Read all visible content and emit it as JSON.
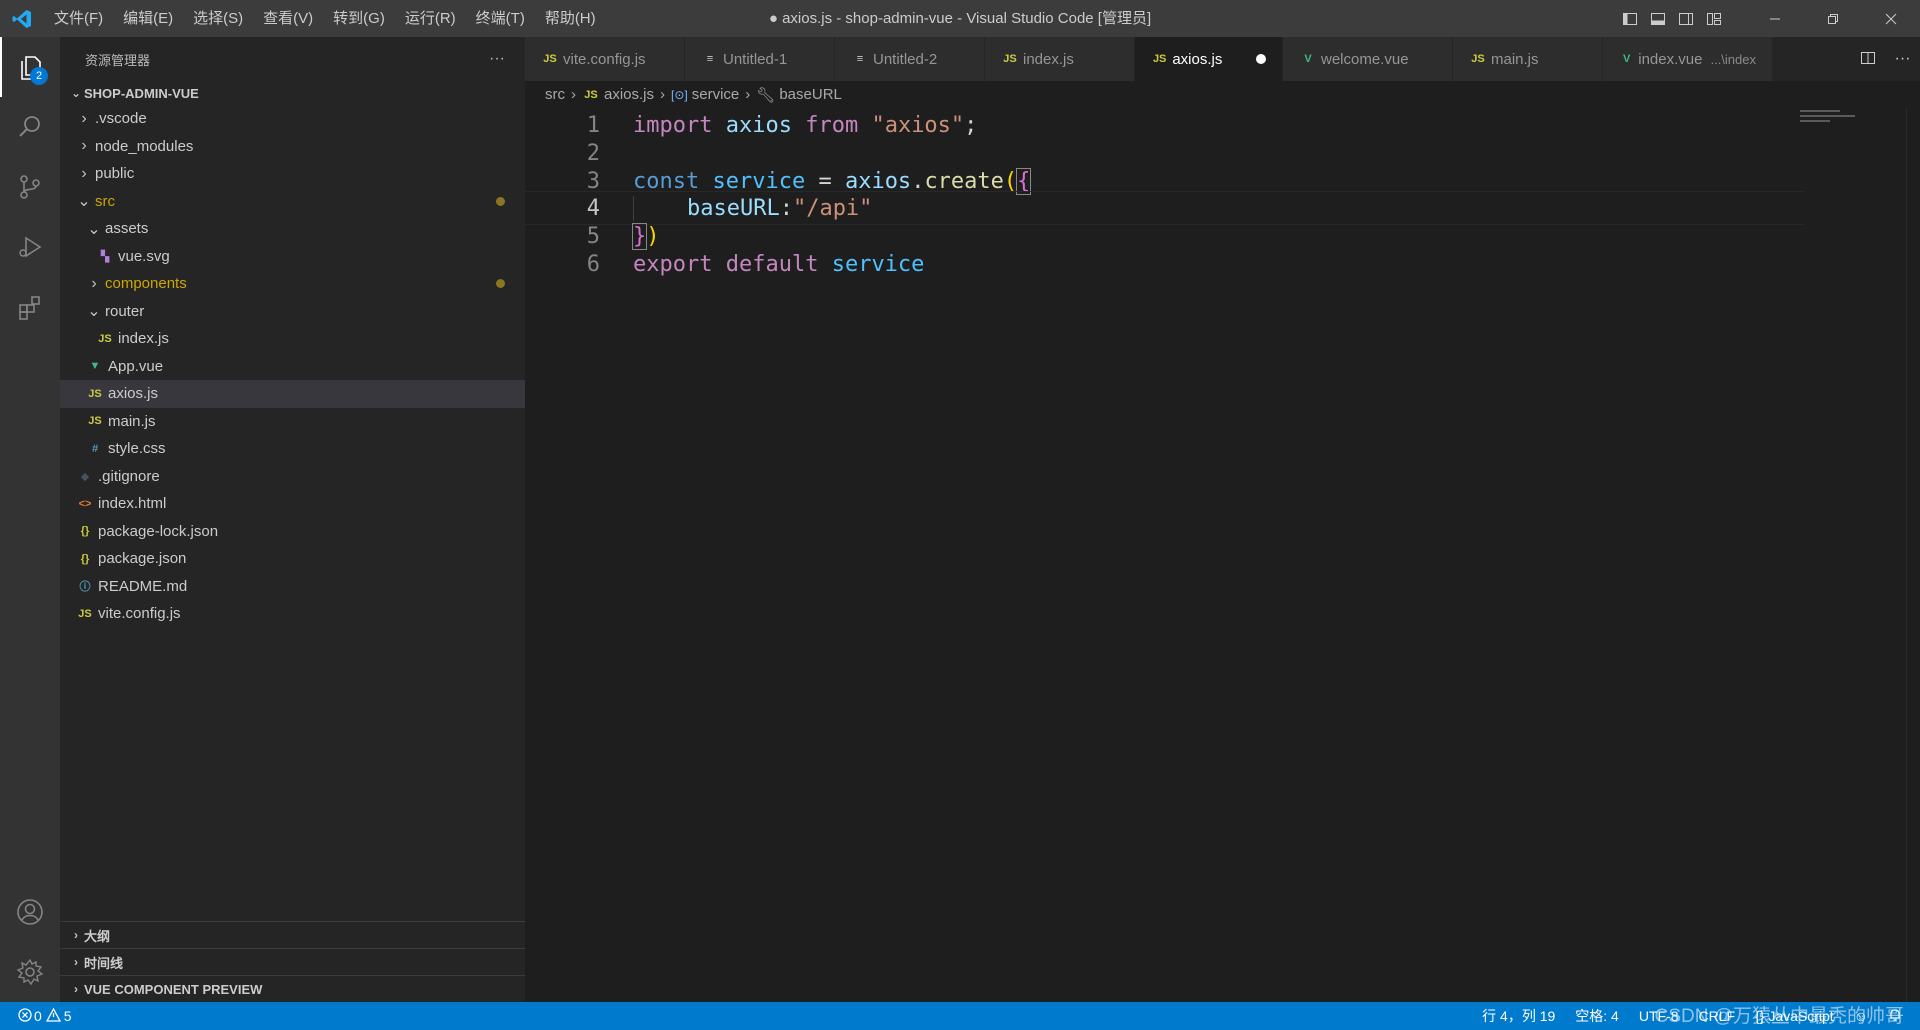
{
  "window": {
    "title": "● axios.js - shop-admin-vue - Visual Studio Code [管理员]"
  },
  "menu": [
    "文件(F)",
    "编辑(E)",
    "选择(S)",
    "查看(V)",
    "转到(G)",
    "运行(R)",
    "终端(T)",
    "帮助(H)"
  ],
  "activity": {
    "explorer_badge": "2"
  },
  "sidebar": {
    "header": "资源管理器",
    "more": "···",
    "project": "SHOP-ADMIN-VUE",
    "tree": [
      {
        "label": ".vscode",
        "type": "folder",
        "expanded": false,
        "depth": 1
      },
      {
        "label": "node_modules",
        "type": "folder",
        "expanded": false,
        "depth": 1
      },
      {
        "label": "public",
        "type": "folder",
        "expanded": false,
        "depth": 1
      },
      {
        "label": "src",
        "type": "folder",
        "expanded": true,
        "depth": 1
      },
      {
        "label": "assets",
        "type": "folder",
        "expanded": true,
        "depth": 2
      },
      {
        "label": "vue.svg",
        "type": "svg",
        "depth": 3
      },
      {
        "label": "components",
        "type": "folder",
        "expanded": false,
        "depth": 2
      },
      {
        "label": "router",
        "type": "folder",
        "expanded": true,
        "depth": 2
      },
      {
        "label": "index.js",
        "type": "js",
        "depth": 3
      },
      {
        "label": "App.vue",
        "type": "vue",
        "depth": 2
      },
      {
        "label": "axios.js",
        "type": "js",
        "depth": 2
      },
      {
        "label": "main.js",
        "type": "js",
        "depth": 2
      },
      {
        "label": "style.css",
        "type": "css",
        "depth": 2
      },
      {
        "label": ".gitignore",
        "type": "git",
        "depth": 1
      },
      {
        "label": "index.html",
        "type": "html",
        "depth": 1
      },
      {
        "label": "package-lock.json",
        "type": "json",
        "depth": 1
      },
      {
        "label": "package.json",
        "type": "json",
        "depth": 1
      },
      {
        "label": "README.md",
        "type": "info",
        "depth": 1
      },
      {
        "label": "vite.config.js",
        "type": "js",
        "depth": 1
      }
    ],
    "bottom_sections": [
      "大纲",
      "时间线",
      "VUE COMPONENT PREVIEW"
    ]
  },
  "tabs": [
    {
      "label": "vite.config.js",
      "icon": "JS"
    },
    {
      "label": "Untitled-1",
      "icon": "≡"
    },
    {
      "label": "Untitled-2",
      "icon": "≡"
    },
    {
      "label": "index.js",
      "icon": "JS"
    },
    {
      "label": "axios.js",
      "icon": "JS"
    },
    {
      "label": "welcome.vue",
      "icon": "V"
    },
    {
      "label": "main.js",
      "icon": "JS"
    },
    {
      "label": "index.vue",
      "icon": "V",
      "desc": "...\\index"
    }
  ],
  "breadcrumb": [
    "src",
    "axios.js",
    "service",
    "baseURL"
  ],
  "code": {
    "line_numbers": [
      "1",
      "2",
      "3",
      "4",
      "5",
      "6"
    ],
    "l1": {
      "import": "import",
      "axios": "axios",
      "from": "from",
      "str": "\"axios\"",
      "semi": ";"
    },
    "l3": {
      "const": "const",
      "service": "service",
      "eq": " = ",
      "axios": "axios",
      "dot": ".",
      "create": "create",
      "paren": "(",
      "brace": "{"
    },
    "l4": {
      "indent": "    ",
      "key": "baseURL",
      "colon": ":",
      "str": "\"/api\""
    },
    "l5": {
      "brace": "}",
      "paren": ")"
    },
    "l6": {
      "export": "export",
      "default": "default",
      "service": "service"
    }
  },
  "status": {
    "errors": "0",
    "warnings": "5",
    "position": "行 4，列 19",
    "spaces": "空格: 4",
    "encoding": "UTF-8",
    "eol": "CRLF",
    "language": "{} JavaScript"
  },
  "watermark": "CSDN @万猿丛中最秃的帅哥",
  "colors": {
    "accent": "#007acc",
    "modified": "#cca700",
    "js_icon": "#cbcb41",
    "vue_icon": "#41b883"
  }
}
